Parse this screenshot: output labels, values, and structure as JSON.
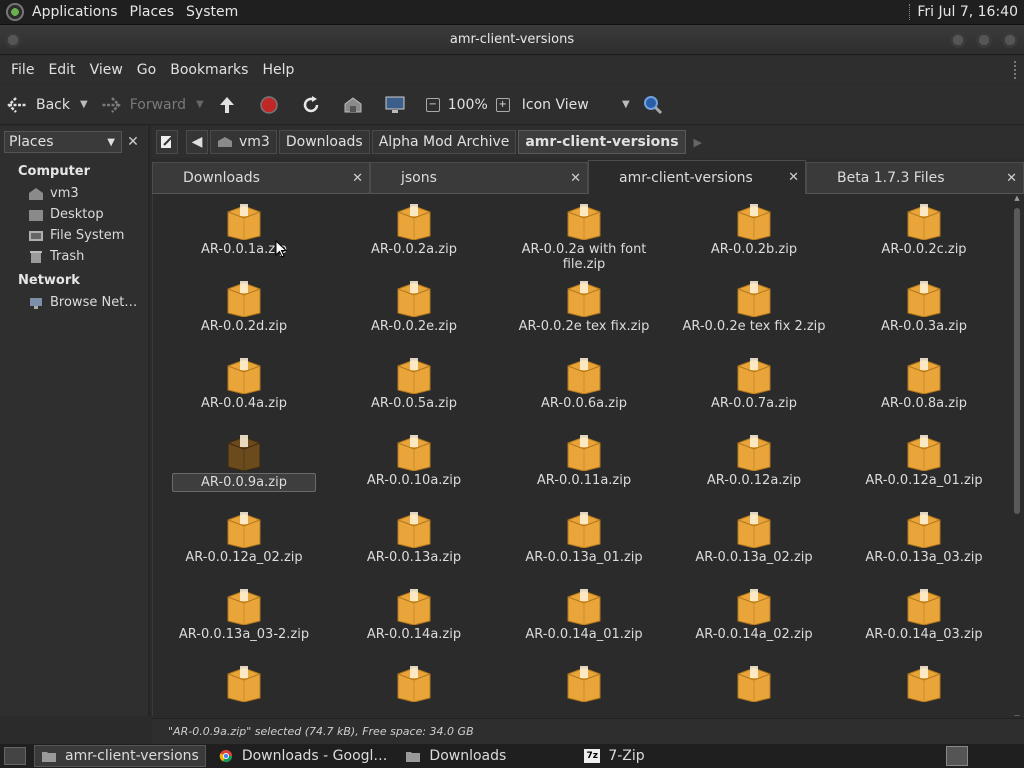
{
  "top_panel": {
    "menus": [
      "Applications",
      "Places",
      "System"
    ],
    "clock": "Fri Jul 7, 16:40"
  },
  "window": {
    "title": "amr-client-versions"
  },
  "menubar": [
    "File",
    "Edit",
    "View",
    "Go",
    "Bookmarks",
    "Help"
  ],
  "toolbar": {
    "back": "Back",
    "forward": "Forward",
    "zoom": "100%",
    "view_mode": "Icon View"
  },
  "sidebar": {
    "selector": "Places",
    "sections": [
      {
        "title": "Computer",
        "items": [
          "vm3",
          "Desktop",
          "File System",
          "Trash"
        ]
      },
      {
        "title": "Network",
        "items": [
          "Browse Net…"
        ]
      }
    ]
  },
  "pathbar": [
    "vm3",
    "Downloads",
    "Alpha Mod Archive",
    "amr-client-versions"
  ],
  "tabs": [
    "Downloads",
    "jsons",
    "amr-client-versions",
    "Beta 1.7.3 Files"
  ],
  "files": [
    [
      "AR-0.0.1a.zip",
      "AR-0.0.2a.zip",
      "AR-0.0.2a with font file.zip",
      "AR-0.0.2b.zip",
      "AR-0.0.2c.zip"
    ],
    [
      "AR-0.0.2d.zip",
      "AR-0.0.2e.zip",
      "AR-0.0.2e tex fix.zip",
      "AR-0.0.2e tex fix 2.zip",
      "AR-0.0.3a.zip"
    ],
    [
      "AR-0.0.4a.zip",
      "AR-0.0.5a.zip",
      "AR-0.0.6a.zip",
      "AR-0.0.7a.zip",
      "AR-0.0.8a.zip"
    ],
    [
      "AR-0.0.9a.zip",
      "AR-0.0.10a.zip",
      "AR-0.0.11a.zip",
      "AR-0.0.12a.zip",
      "AR-0.0.12a_01.zip"
    ],
    [
      "AR-0.0.12a_02.zip",
      "AR-0.0.13a.zip",
      "AR-0.0.13a_01.zip",
      "AR-0.0.13a_02.zip",
      "AR-0.0.13a_03.zip"
    ],
    [
      "AR-0.0.13a_03-2.zip",
      "AR-0.0.14a.zip",
      "AR-0.0.14a_01.zip",
      "AR-0.0.14a_02.zip",
      "AR-0.0.14a_03.zip"
    ],
    [
      "",
      "",
      "",
      "",
      ""
    ]
  ],
  "selected_file": "AR-0.0.9a.zip",
  "status": "\"AR-0.0.9a.zip\" selected (74.7 kB), Free space: 34.0 GB",
  "taskbar": {
    "tasks": [
      "amr-client-versions",
      "Downloads - Googl…",
      "Downloads",
      "7-Zip"
    ]
  },
  "colors": {
    "package": "#e9a53a",
    "package_selected": "#6b4a1e",
    "accent_red": "#d03030"
  }
}
